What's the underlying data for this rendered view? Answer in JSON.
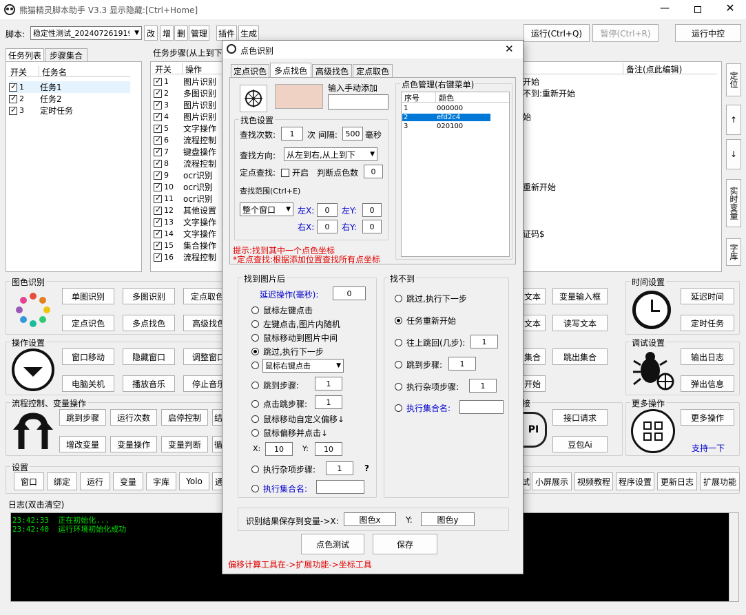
{
  "window": {
    "title": "熊猫精灵脚本助手  V3.3  显示隐藏:[Ctrl+Home]"
  },
  "toolbar": {
    "script_label": "脚本:",
    "script_value": "稳定性测试_2024072619191",
    "buttons": [
      "改",
      "增",
      "删",
      "管理",
      "插件",
      "生成"
    ],
    "run": "运行(Ctrl+Q)",
    "pause": "暂停(Ctrl+R)",
    "run_center": "运行中控"
  },
  "task_tabs": [
    "任务列表",
    "步骤集合"
  ],
  "task_table": {
    "headers": [
      "开关",
      "任务名"
    ],
    "rows": [
      [
        "1",
        "任务1"
      ],
      [
        "2",
        "任务2"
      ],
      [
        "3",
        "定时任务"
      ]
    ]
  },
  "steps_panel": {
    "title": "任务步骤(从上到下",
    "headers": [
      "开关",
      "操作"
    ],
    "rows": [
      [
        "1",
        "图片识别"
      ],
      [
        "2",
        "多图识别"
      ],
      [
        "3",
        "图片识别"
      ],
      [
        "4",
        "图片识别"
      ],
      [
        "5",
        "文字操作"
      ],
      [
        "6",
        "流程控制"
      ],
      [
        "7",
        "键盘操作"
      ],
      [
        "8",
        "流程控制"
      ],
      [
        "9",
        "ocr识别"
      ],
      [
        "10",
        "ocr识别"
      ],
      [
        "11",
        "ocr识别"
      ],
      [
        "12",
        "其他设置"
      ],
      [
        "13",
        "文字操作"
      ],
      [
        "14",
        "文字操作"
      ],
      [
        "15",
        "集合操作"
      ],
      [
        "16",
        "流程控制"
      ]
    ],
    "remark_header": "备注(点此编辑)",
    "peek": [
      "开始",
      "不到:重新开始",
      "",
      "始",
      "",
      "",
      "",
      "",
      "",
      "重新开始",
      "",
      "",
      "",
      "证码$"
    ]
  },
  "side_buttons": [
    "定位",
    "↑",
    "↓",
    "实时变量",
    "字库"
  ],
  "sections": {
    "image": {
      "title": "图色识别",
      "buttons": [
        "单图识别",
        "多图识别",
        "定点取色",
        "定点识色",
        "多点找色",
        "高级找色"
      ]
    },
    "ops": {
      "title": "操作设置",
      "buttons": [
        "窗口移动",
        "隐藏窗口",
        "调整窗口",
        "电脑关机",
        "播放音乐",
        "停止音乐"
      ]
    },
    "flow": {
      "title": "流程控制、变量操作",
      "buttons": [
        "跳到步骤",
        "运行次数",
        "启停控制",
        "结",
        "增改变量",
        "变量操作",
        "变量判断",
        "循"
      ]
    },
    "settings": {
      "title": "设置",
      "buttons": [
        "窗口",
        "绑定",
        "运行",
        "变量",
        "字库",
        "Yolo",
        "通"
      ]
    },
    "settings_right": [
      "试",
      "小屏展示",
      "视频教程",
      "程序设置",
      "更新日志",
      "扩展功能"
    ],
    "mid_right": [
      "文本",
      "变量输入框",
      "文本",
      "读写文本",
      "集合",
      "跳出集合",
      "开始"
    ],
    "interface": {
      "title": "接",
      "buttons": [
        "接口请求",
        "豆包Ai"
      ]
    },
    "time": {
      "title": "时间设置",
      "buttons": [
        "延迟时间",
        "定时任务"
      ]
    },
    "debug": {
      "title": "调试设置",
      "buttons": [
        "输出日志",
        "弹出信息"
      ]
    },
    "more": {
      "title": "更多操作",
      "buttons": [
        "更多操作"
      ],
      "link": "支持一下"
    }
  },
  "log": {
    "title": "日志(双击清空)",
    "lines": [
      [
        "23:42:33",
        "正在初始化..."
      ],
      [
        "23:42:40",
        "运行环境初始化成功"
      ]
    ]
  },
  "dialog": {
    "title": "点色识别",
    "tabs": [
      "定点识色",
      "多点找色",
      "高级找色",
      "定点取色"
    ],
    "manual_add": "输入手动添加",
    "color_mgmt_title": "点色管理(右键菜单)",
    "color_headers": [
      "序号",
      "颜色"
    ],
    "colors": [
      [
        "1",
        "000000"
      ],
      [
        "2",
        "efd2c4"
      ],
      [
        "3",
        "020100"
      ]
    ],
    "search_settings_title": "找色设置",
    "search_count_label": "查找次数:",
    "search_count": "1",
    "times_label": "次 间隔:",
    "interval": "500",
    "ms_label": "毫秒",
    "direction_label": "查找方向:",
    "direction": "从左到右,从上到下",
    "fixed_label": "定点查找:",
    "enable_label": "开启",
    "judge_label": "判断点色数",
    "judge_value": "0",
    "range_label": "查找范围(Ctrl+E)",
    "range_value": "整个窗口",
    "left_x_label": "左X:",
    "left_x": "0",
    "left_y_label": "左Y:",
    "left_y": "0",
    "right_x_label": "右X:",
    "right_x": "0",
    "right_y_label": "右Y:",
    "right_y": "0",
    "hint1": "提示:找到其中一个点色坐标",
    "hint2": "*定点查找:根据添加位置查找所有点坐标",
    "found_title": "找到图片后",
    "delay_label": "延迟操作(毫秒):",
    "delay_value": "0",
    "found_options": [
      "鼠标左键点击",
      "左键点击,图片内随机",
      "鼠标移动到图片中间",
      "跳过,执行下一步",
      "鼠标右键点击",
      "跳到步骤:",
      "点击跳步骤:",
      "鼠标移动自定义偏移↓",
      "鼠标偏移并点击↓"
    ],
    "found_selected": 3,
    "jump_step": "1",
    "click_jump": "1",
    "x_label": "X:",
    "x_value": "10",
    "y_label": "Y:",
    "y_value": "10",
    "misc_label": "执行杂项步骤:",
    "misc_value": "1",
    "question": "?",
    "set_label": "执行集合名:",
    "notfound_title": "找不到",
    "notfound_options": [
      "跳过,执行下一步",
      "任务重新开始",
      "往上跳回(几步):",
      "跳到步骤:",
      "执行杂项步骤:",
      "执行集合名:"
    ],
    "notfound_selected": 1,
    "nf_back": "1",
    "nf_jump": "1",
    "nf_misc": "1",
    "save_label": "识别结果保存到变量->X:",
    "save_x": "图色x",
    "y_var_label": "Y:",
    "save_y": "图色y",
    "test_btn": "点色测试",
    "save_btn": "保存",
    "footer": "偏移计算工具在->扩展功能->坐标工具",
    "accent": "#0078d7",
    "swatch": "#efd2c4"
  }
}
